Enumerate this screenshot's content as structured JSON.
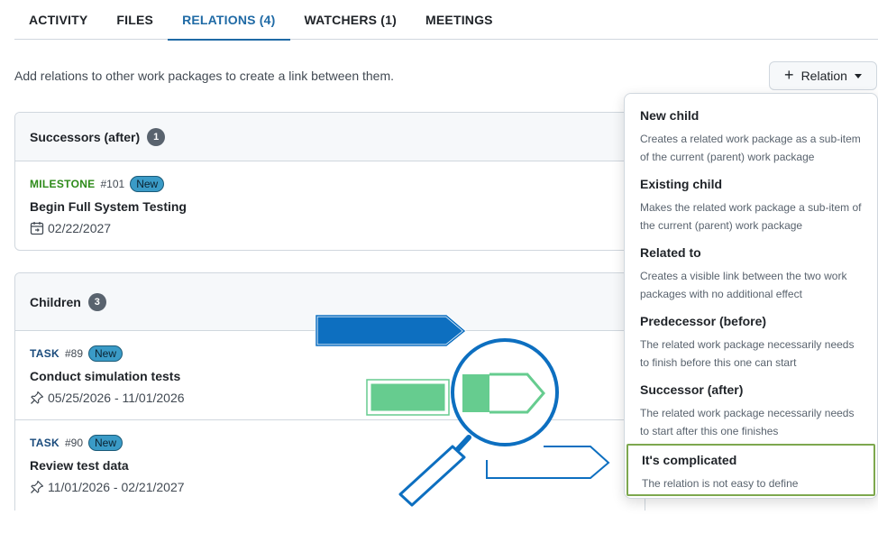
{
  "tabs": [
    {
      "label": "ACTIVITY",
      "active": false
    },
    {
      "label": "FILES",
      "active": false
    },
    {
      "label": "RELATIONS (4)",
      "active": true
    },
    {
      "label": "WATCHERS (1)",
      "active": false
    },
    {
      "label": "MEETINGS",
      "active": false
    }
  ],
  "intro_text": "Add relations to other work packages to create a link between them.",
  "relation_button": {
    "label": "Relation",
    "icon": "plus-icon",
    "caret": "caret-down-icon"
  },
  "successors": {
    "title": "Successors (after)",
    "count": "1",
    "items": [
      {
        "type": "MILESTONE",
        "id": "#101",
        "status": "New",
        "subject": "Begin Full System Testing",
        "dates": "02/22/2027",
        "date_icon": "calendar-icon"
      }
    ]
  },
  "children": {
    "title": "Children",
    "count": "3",
    "items": [
      {
        "type": "TASK",
        "id": "#89",
        "status": "New",
        "subject": "Conduct simulation tests",
        "dates": "05/25/2026 - 11/01/2026",
        "date_icon": "pin-icon"
      },
      {
        "type": "TASK",
        "id": "#90",
        "status": "New",
        "subject": "Review test data",
        "dates": "11/01/2026 - 02/21/2027",
        "date_icon": "pin-icon"
      }
    ]
  },
  "menu": {
    "items": [
      {
        "title": "New child",
        "desc": "Creates a related work package as a sub-item of the current (parent) work package"
      },
      {
        "title": "Existing child",
        "desc": "Makes the related work package a sub-item of the current (parent) work package"
      },
      {
        "title": "Related to",
        "desc": "Creates a visible link between the two work packages with no additional effect"
      },
      {
        "title": "Predecessor (before)",
        "desc": "The related work package necessarily needs to finish before this one can start"
      },
      {
        "title": "Successor (after)",
        "desc": "The related work package necessarily needs to start after this one finishes"
      },
      {
        "title": "It's complicated",
        "desc": "The relation is not easy to define"
      }
    ]
  },
  "colors": {
    "accent": "#1f6aa5",
    "milestone": "#2e8b1a",
    "status_badge": "#3a9bc7",
    "highlight_border": "#7da84e",
    "illustration_blue": "#0d6fc0",
    "illustration_green": "#66cc8f"
  }
}
